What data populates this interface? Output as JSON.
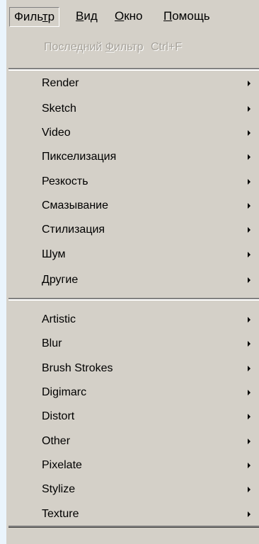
{
  "menubar": {
    "items": [
      {
        "label": "Фильтр",
        "active": true
      },
      {
        "label": "Вид",
        "active": false
      },
      {
        "label": "Окно",
        "active": false
      },
      {
        "label": "Помощь",
        "active": false
      }
    ]
  },
  "last_filter": {
    "label": "Последний Фильтр",
    "shortcut": "Ctrl+F",
    "enabled": false
  },
  "groups": [
    {
      "items": [
        {
          "label": "Render",
          "submenu": true
        },
        {
          "label": "Sketch",
          "submenu": true
        },
        {
          "label": "Video",
          "submenu": true
        },
        {
          "label": "Пикселизация",
          "submenu": true
        },
        {
          "label": "Резкость",
          "submenu": true
        },
        {
          "label": "Смазывание",
          "submenu": true
        },
        {
          "label": "Стилизация",
          "submenu": true
        },
        {
          "label": "Шум",
          "submenu": true
        },
        {
          "label": "Другие",
          "submenu": true
        }
      ]
    },
    {
      "items": [
        {
          "label": "Artistic",
          "submenu": true
        },
        {
          "label": "Blur",
          "submenu": true
        },
        {
          "label": "Brush Strokes",
          "submenu": true
        },
        {
          "label": "Digimarc",
          "submenu": true
        },
        {
          "label": "Distort",
          "submenu": true
        },
        {
          "label": "Other",
          "submenu": true
        },
        {
          "label": "Pixelate",
          "submenu": true
        },
        {
          "label": "Stylize",
          "submenu": true
        },
        {
          "label": "Texture",
          "submenu": true
        }
      ]
    }
  ],
  "colors": {
    "menu_background": "#d4d0c8",
    "page_background": "#eaf4fc",
    "disabled_text": "#a6a29a"
  }
}
